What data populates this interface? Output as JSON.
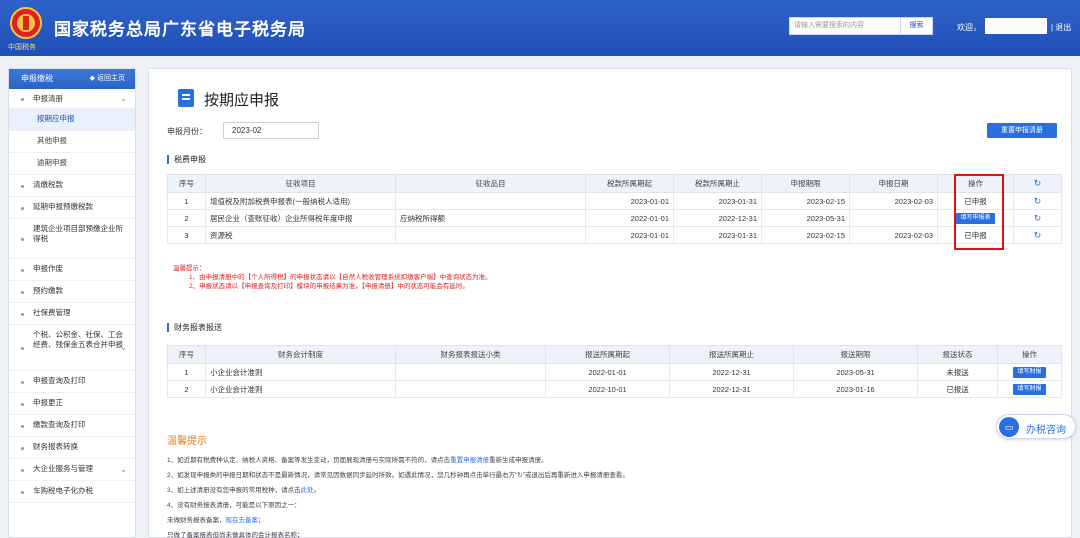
{
  "header": {
    "site_title": "国家税务总局广东省电子税务局",
    "emblem_text": "中国税务",
    "search_placeholder": "请输入需要搜索的内容",
    "search_button": "搜索",
    "welcome": "欢迎，",
    "logout": "| 退出"
  },
  "sidebar": {
    "head_title": "申报缴税",
    "back_label": "◆ 返回主页",
    "items": [
      {
        "label": "申报清册",
        "expandable": true
      },
      {
        "label": "按期应申报",
        "sub": true,
        "active": true
      },
      {
        "label": "其他申报",
        "sub": true
      },
      {
        "label": "逾期申报",
        "sub": true
      },
      {
        "label": "清缴税款"
      },
      {
        "label": "延期申报预缴税款"
      },
      {
        "label": "建筑企业项目部预缴企业所得税"
      },
      {
        "label": "申报作废"
      },
      {
        "label": "预约缴款"
      },
      {
        "label": "社保费管理"
      },
      {
        "label": "个税、公积金、社保、工会经费、残保金五表合并申报",
        "expandable": true
      },
      {
        "label": "申报查询及打印"
      },
      {
        "label": "申报更正"
      },
      {
        "label": "缴款查询及打印"
      },
      {
        "label": "财务报表转换"
      },
      {
        "label": "大企业服务与管理",
        "expandable": true
      },
      {
        "label": "车购税电子化办税"
      }
    ]
  },
  "main": {
    "page_title": "按期应申报",
    "period_label": "申报月份：",
    "period_value": "2023-02",
    "reset_button": "重置申报清册",
    "tax_section_title": "税费申报",
    "tax_table": {
      "headers": [
        "序号",
        "征收项目",
        "征收品目",
        "税款所属期起",
        "税款所属期止",
        "申报期限",
        "申报日期",
        "操作"
      ],
      "rows": [
        {
          "no": "1",
          "item": "增值税及附加税费申报表(一般纳税人适用)",
          "sub": "",
          "start": "2023-01-01",
          "end": "2023-01-31",
          "deadline": "2023-02-15",
          "filed": "2023-02-03",
          "action": "已申报",
          "action_button": false
        },
        {
          "no": "2",
          "item": "居民企业（查账征收）企业所得税年度申报",
          "sub": "应纳税所得额",
          "start": "2022-01-01",
          "end": "2022-12-31",
          "deadline": "2023-05-31",
          "filed": "",
          "action": "填写申报表",
          "action_button": true
        },
        {
          "no": "3",
          "item": "资源税",
          "sub": "",
          "start": "2023-01-01",
          "end": "2023-01-31",
          "deadline": "2023-02-15",
          "filed": "2023-02-03",
          "action": "已申报",
          "action_button": false
        }
      ]
    },
    "warning": [
      "温馨提示：",
      "1、由申报清册中的【个人所得税】的申报状态请以【自然人税收管理系统扣缴客户端】中查询状态为准。",
      "2、申报状态请以【申报查询及打印】模块的申报结果为准，【申报清册】中的状态可能会有延时。"
    ],
    "finance_section_title": "财务报表报送",
    "finance_table": {
      "headers": [
        "序号",
        "财务会计制度",
        "财务报表报送小类",
        "报送所属期起",
        "报送所属期止",
        "报送期限",
        "报送状态",
        "操作"
      ],
      "rows": [
        {
          "no": "1",
          "system": "小企业会计准则",
          "sub": "",
          "start": "2022-01-01",
          "end": "2022-12-31",
          "deadline": "2023-05-31",
          "status": "未报送",
          "action": "填写财报"
        },
        {
          "no": "2",
          "system": "小企业会计准则",
          "sub": "",
          "start": "2022-10-01",
          "end": "2022-12-31",
          "deadline": "2023-01-16",
          "status": "已报送",
          "action": "填写财报"
        }
      ]
    },
    "tips_title": "温馨提示",
    "tips": {
      "line1_a": "1、如近期有税费种认定、纳税人资格、备案等发生变动，页面展现清册与实际所需不符的，请点击",
      "line1_link": "重置申报清册",
      "line1_b": "重新生成申报清册。",
      "line2": "2、如发现申报类的申报日期和状态不是最新情况，请常见因数据同步延时所致。如遇此情况，您几秒钟再点击单行最右方“↻”或退出后再重新进入申报清册查看。",
      "line3_a": "3、如上述清册没有您申报的常用税种，请点击",
      "line3_link": "此处",
      "line3_b": "。",
      "line4": "4、没有财务报表清册，可能是以下原因之一：",
      "line5_a": "未做财务报表备案，",
      "line5_link": "现在去备案",
      "line5_b": "；",
      "line6": "只做了备案报表但尚未做具体的会计报表名称；"
    }
  },
  "consult": {
    "label": "办税咨询",
    "icon": "chat-icon"
  },
  "colors": {
    "brand_blue": "#2a6fe0",
    "header_blue": "#1f4fb8",
    "highlight_red": "#e01010",
    "tips_orange": "#e87a10"
  }
}
